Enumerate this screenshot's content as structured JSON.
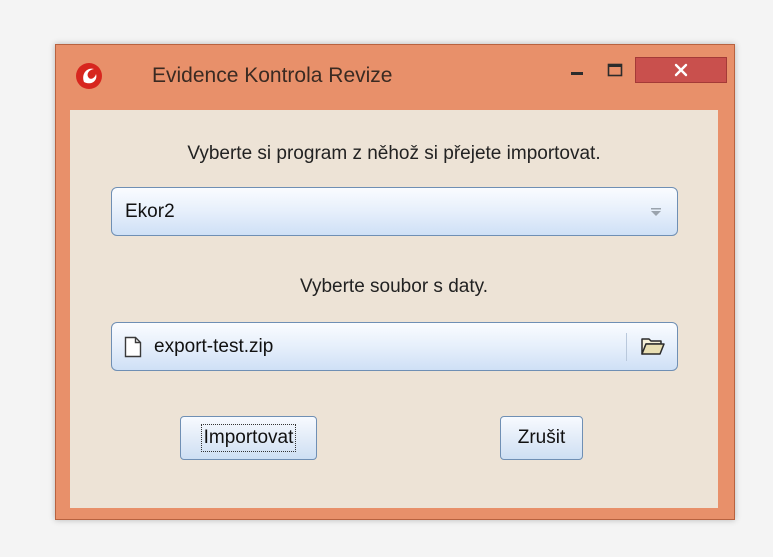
{
  "window": {
    "title": "Evidence Kontrola Revize",
    "minimize_label": "–",
    "maximize_label": "□",
    "close_label": "×"
  },
  "form": {
    "program_prompt": "Vyberte si program z něhož si přejete importovat.",
    "program_selected": "Ekor2",
    "file_prompt": "Vyberte soubor s daty.",
    "file_name": "export-test.zip",
    "import_button": "Importovat",
    "cancel_button": "Zrušit"
  },
  "icons": {
    "app": "app-logo-icon",
    "dropdown": "dropdown-arrow-icon",
    "file": "file-icon",
    "folder": "folder-open-icon"
  },
  "colors": {
    "frame": "#e8906a",
    "close_button": "#c9504d",
    "client_background": "#ede3d6"
  }
}
